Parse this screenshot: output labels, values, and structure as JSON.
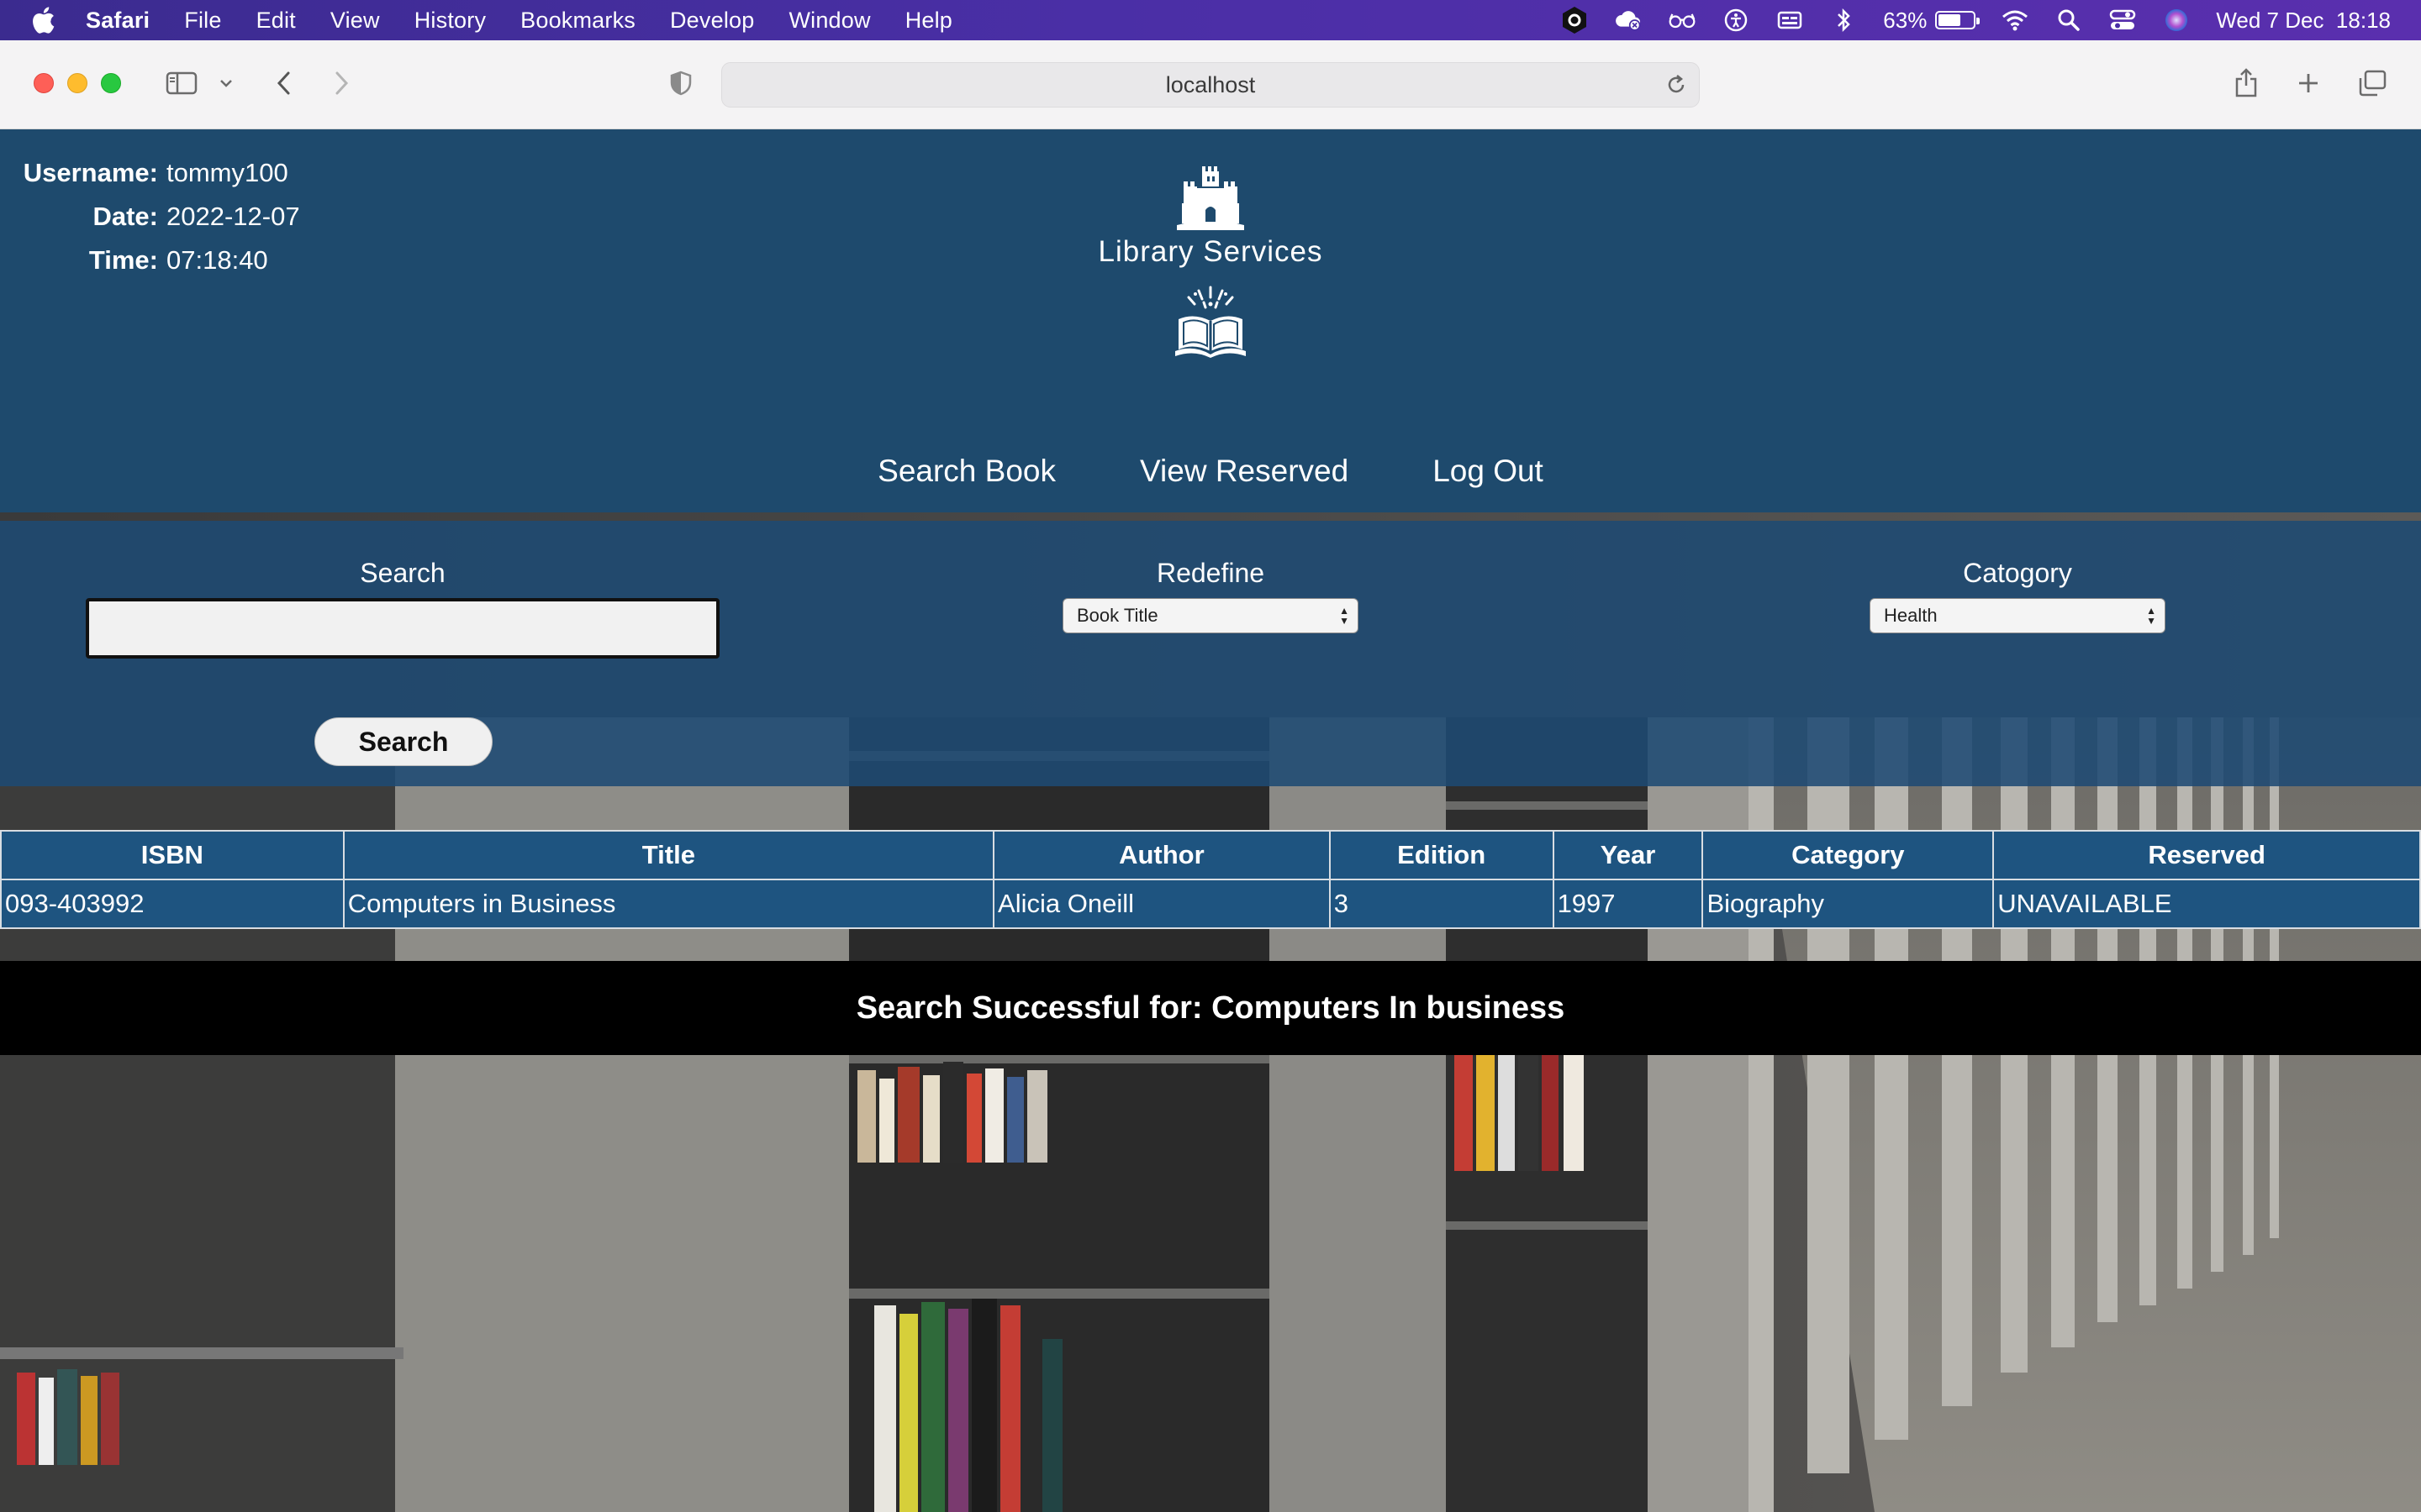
{
  "menubar": {
    "app_name": "Safari",
    "items": [
      "File",
      "Edit",
      "View",
      "History",
      "Bookmarks",
      "Develop",
      "Window",
      "Help"
    ],
    "battery_percent": "63%",
    "battery_level": 0.63,
    "datetime": "Wed 7 Dec  18:18",
    "status_icons": [
      "hexagon-app-icon",
      "creative-cloud-icon",
      "glasses-icon",
      "accessibility-icon",
      "keyboard-icon",
      "bluetooth-icon",
      "battery-icon",
      "wifi-icon",
      "spotlight-search-icon",
      "control-center-icon",
      "siri-icon"
    ]
  },
  "browser": {
    "url": "localhost",
    "toolbar_icons": [
      "sidebar-icon",
      "chevron-down-icon",
      "back-icon",
      "forward-icon",
      "shield-icon",
      "share-icon",
      "new-tab-icon",
      "tab-overview-icon",
      "reload-icon"
    ]
  },
  "header": {
    "username_label": "Username:",
    "username": "tommy100",
    "date_label": "Date:",
    "date": "2022-12-07",
    "time_label": "Time:",
    "time": "07:18:40",
    "logo_title": "Library Services"
  },
  "nav": {
    "search_book": "Search Book",
    "view_reserved": "View Reserved",
    "log_out": "Log Out"
  },
  "search": {
    "search_label": "Search",
    "search_value": "",
    "redefine_label": "Redefine",
    "redefine_selected": "Book Title",
    "category_label": "Catogory",
    "category_selected": "Health",
    "button_label": "Search"
  },
  "results": {
    "columns": [
      "ISBN",
      "Title",
      "Author",
      "Edition",
      "Year",
      "Category",
      "Reserved"
    ],
    "rows": [
      [
        "093-403992",
        "Computers in Business",
        "Alicia Oneill",
        "3",
        "1997",
        "Biography",
        "UNAVAILABLE"
      ]
    ]
  },
  "status_message": "Search Successful for: Computers In business",
  "colors": {
    "header_bg": "#1e4a6d",
    "panel_bg": "#1e4a73",
    "table_bg": "#1e5480",
    "status_bg": "#000000"
  }
}
